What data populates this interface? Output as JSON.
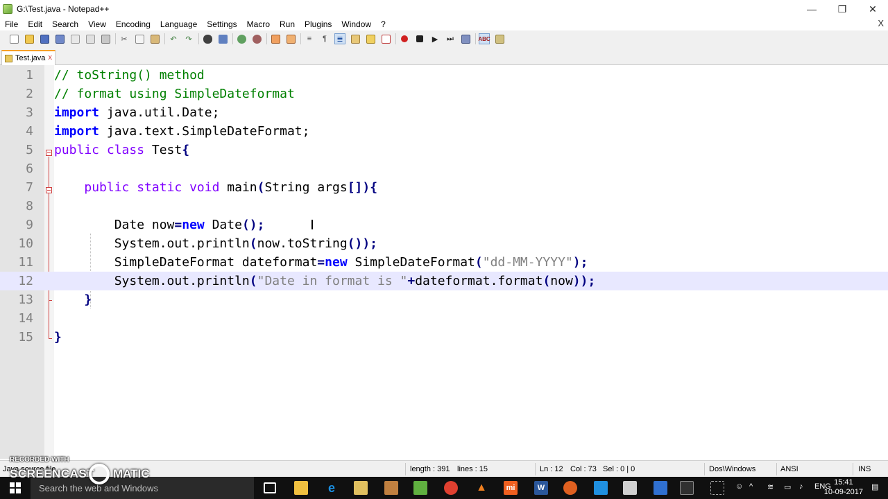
{
  "window": {
    "title": "G:\\Test.java - Notepad++",
    "minimize": "—",
    "restore": "❐",
    "close": "✕"
  },
  "menu": {
    "items": [
      "File",
      "Edit",
      "Search",
      "View",
      "Encoding",
      "Language",
      "Settings",
      "Macro",
      "Run",
      "Plugins",
      "Window",
      "?"
    ],
    "doc_close": "X"
  },
  "tab": {
    "label": "Test.java",
    "close": "x"
  },
  "editor": {
    "current_line": 12,
    "lines": [
      {
        "n": "1",
        "tokens": [
          {
            "t": "// toString() method",
            "c": "c-comment"
          }
        ]
      },
      {
        "n": "2",
        "tokens": [
          {
            "t": "// format using SimpleDateformat",
            "c": "c-comment"
          }
        ]
      },
      {
        "n": "3",
        "tokens": [
          {
            "t": "import",
            "c": "c-kw"
          },
          {
            "t": " java.util.Date;",
            "c": "c-plain"
          }
        ]
      },
      {
        "n": "4",
        "tokens": [
          {
            "t": "import",
            "c": "c-kw"
          },
          {
            "t": " java.text.SimpleDateFormat;",
            "c": "c-plain"
          }
        ]
      },
      {
        "n": "5",
        "tokens": [
          {
            "t": "public class",
            "c": "c-type"
          },
          {
            "t": " Test",
            "c": "c-plain"
          },
          {
            "t": "{",
            "c": "c-op"
          }
        ]
      },
      {
        "n": "6",
        "tokens": []
      },
      {
        "n": "7",
        "tokens": [
          {
            "t": "    ",
            "c": "c-plain"
          },
          {
            "t": "public static void",
            "c": "c-type"
          },
          {
            "t": " main",
            "c": "c-plain"
          },
          {
            "t": "(",
            "c": "c-op"
          },
          {
            "t": "String args",
            "c": "c-plain"
          },
          {
            "t": "[]){",
            "c": "c-op"
          }
        ]
      },
      {
        "n": "8",
        "tokens": []
      },
      {
        "n": "9",
        "tokens": [
          {
            "t": "        Date now",
            "c": "c-plain"
          },
          {
            "t": "=",
            "c": "c-op"
          },
          {
            "t": "new",
            "c": "c-kw"
          },
          {
            "t": " Date",
            "c": "c-plain"
          },
          {
            "t": "();",
            "c": "c-op"
          }
        ]
      },
      {
        "n": "10",
        "tokens": [
          {
            "t": "        System.out.println",
            "c": "c-plain"
          },
          {
            "t": "(",
            "c": "c-op"
          },
          {
            "t": "now.toString",
            "c": "c-plain"
          },
          {
            "t": "());",
            "c": "c-op"
          }
        ]
      },
      {
        "n": "11",
        "tokens": [
          {
            "t": "        SimpleDateFormat dateformat",
            "c": "c-plain"
          },
          {
            "t": "=",
            "c": "c-op"
          },
          {
            "t": "new",
            "c": "c-kw"
          },
          {
            "t": " SimpleDateFormat",
            "c": "c-plain"
          },
          {
            "t": "(",
            "c": "c-op"
          },
          {
            "t": "\"dd-MM-YYYY\"",
            "c": "c-str"
          },
          {
            "t": ");",
            "c": "c-op"
          }
        ]
      },
      {
        "n": "12",
        "tokens": [
          {
            "t": "        System.out.println",
            "c": "c-plain"
          },
          {
            "t": "(",
            "c": "c-op"
          },
          {
            "t": "\"Date in format is \"",
            "c": "c-str"
          },
          {
            "t": "+",
            "c": "c-op"
          },
          {
            "t": "dateformat.format",
            "c": "c-plain"
          },
          {
            "t": "(",
            "c": "c-op"
          },
          {
            "t": "now",
            "c": "c-plain"
          },
          {
            "t": "));",
            "c": "c-op"
          }
        ]
      },
      {
        "n": "13",
        "tokens": [
          {
            "t": "    ",
            "c": "c-plain"
          },
          {
            "t": "}",
            "c": "c-op"
          }
        ]
      },
      {
        "n": "14",
        "tokens": []
      },
      {
        "n": "15",
        "tokens": [
          {
            "t": "}",
            "c": "c-op"
          }
        ]
      }
    ]
  },
  "status": {
    "file_type": "Java source file",
    "length": "length : 391",
    "lines": "lines : 15",
    "ln": "Ln : 12",
    "col": "Col : 73",
    "sel": "Sel : 0 | 0",
    "eol": "Dos\\Windows",
    "encoding": "ANSI",
    "mode": "INS"
  },
  "watermark": {
    "top": "RECORDED WITH",
    "left": "SCREENCAST",
    "right": "MATIC"
  },
  "taskbar": {
    "search_placeholder": "Search the web and Windows",
    "language": "ENG",
    "time": "15:41",
    "date": "10-09-2017"
  },
  "colors": {
    "accent_tab": "#f6a028",
    "comment": "#008000",
    "keyword": "#0000ff",
    "type": "#8000ff",
    "string": "#808080",
    "current_line": "#e8e8ff"
  }
}
